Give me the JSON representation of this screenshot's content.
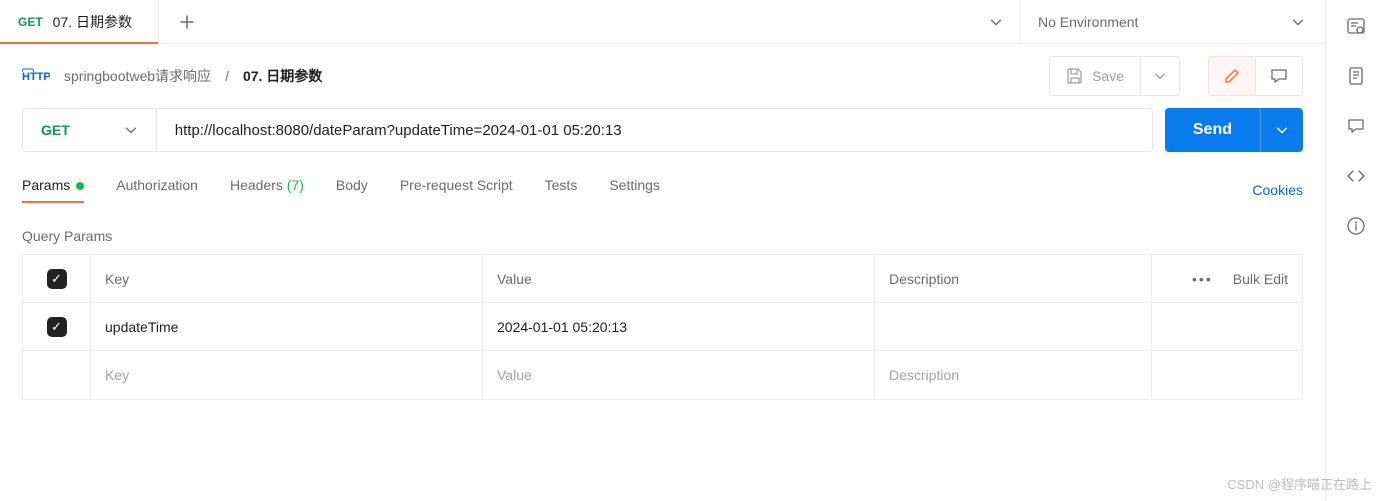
{
  "tab": {
    "method": "GET",
    "title": "07. 日期参数"
  },
  "env": {
    "label": "No Environment"
  },
  "breadcrumb": {
    "collection": "springbootweb请求响应",
    "request": "07. 日期参数"
  },
  "actions": {
    "save": "Save"
  },
  "request": {
    "method": "GET",
    "url": "http://localhost:8080/dateParam?updateTime=2024-01-01 05:20:13",
    "send": "Send"
  },
  "reqTabs": {
    "params": "Params",
    "auth": "Authorization",
    "headers": "Headers",
    "headersCount": "(7)",
    "body": "Body",
    "prereq": "Pre-request Script",
    "tests": "Tests",
    "settings": "Settings",
    "cookies": "Cookies"
  },
  "params": {
    "sectionTitle": "Query Params",
    "headers": {
      "key": "Key",
      "value": "Value",
      "desc": "Description",
      "bulk": "Bulk Edit"
    },
    "rows": [
      {
        "key": "updateTime",
        "value": "2024-01-01 05:20:13",
        "desc": ""
      }
    ],
    "placeholders": {
      "key": "Key",
      "value": "Value",
      "desc": "Description"
    }
  },
  "watermark": "CSDN @程序喵正在路上"
}
